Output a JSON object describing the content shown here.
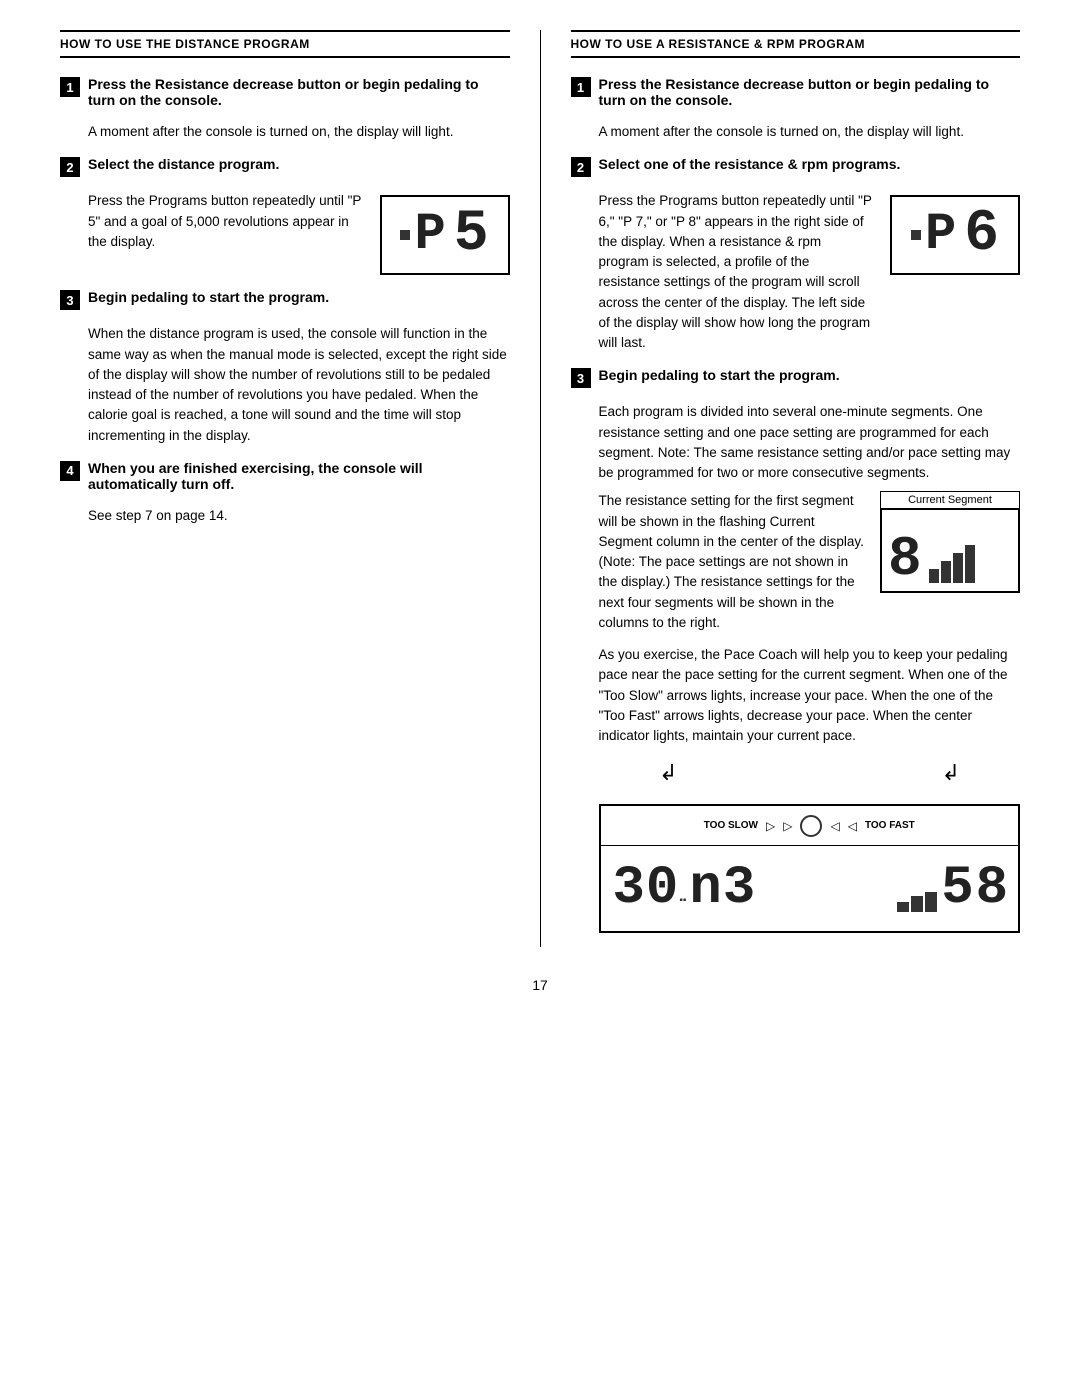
{
  "left_col": {
    "header": "HOW TO USE THE DISTANCE PROGRAM",
    "step1": {
      "number": "1",
      "title": "Press the Resistance decrease button or begin pedaling to turn on the console.",
      "body": "A moment after the console is turned on, the display will light."
    },
    "step2": {
      "number": "2",
      "title": "Select the distance program.",
      "body_pre": "Press the Programs button repeatedly until \"P 5\" and a goal of 5,000 revolutions appear in the display."
    },
    "step3": {
      "number": "3",
      "title": "Begin pedaling to start the program.",
      "body": "When the distance program is used, the console will function in the same way as when the manual mode is selected, except the right side of the display will show the number of revolutions still to be pedaled instead of the number of revolutions you have pedaled. When the calorie goal is reached, a tone will sound and the time will stop incrementing in the display."
    },
    "step4": {
      "number": "4",
      "title": "When you are finished exercising, the console will automatically turn off.",
      "body": "See step 7 on page 14."
    }
  },
  "right_col": {
    "header": "HOW TO USE A RESISTANCE & RPM PROGRAM",
    "step1": {
      "number": "1",
      "title": "Press the Resistance decrease button or begin pedaling to turn on the console.",
      "body": "A moment after the console is turned on, the display will light."
    },
    "step2": {
      "number": "2",
      "title": "Select one of the resistance & rpm programs.",
      "body_pre": "Press the Programs button repeatedly until \"P 6,\" \"P 7,\" or \"P 8\" appears in the right side of the display. When a resistance & rpm program is selected, a profile of the resistance settings of the program will scroll across the center of the display. The left side of the display will show how long the program will last."
    },
    "step3": {
      "number": "3",
      "title": "Begin pedaling to start the program.",
      "body_seg_text": "Each program is divided into several one-minute segments. One resistance setting and one pace setting are programmed for each segment. Note: The same resistance setting and/or pace setting may be programmed for two or more consecutive segments.",
      "body_seg_text2": "The resistance setting for the first segment will be shown in the flashing Current Segment column in the center of the display. (Note: The pace settings are not shown in the display.) The resistance settings for the next four segments will be shown in the columns to the right.",
      "segment_label": "Current Segment",
      "body_pace_text": "As you exercise, the Pace Coach will help you to keep your pedaling pace near the pace setting for the current segment. When one of the \"Too Slow\" arrows lights, increase your pace. When the one of the \"Too Fast\" arrows lights, decrease your pace. When the center indicator lights, maintain your current pace."
    }
  },
  "displays": {
    "p5_chars": [
      "P",
      "5"
    ],
    "p6_chars": [
      "P",
      "6"
    ],
    "segment_big_char": "8",
    "segment_bars": [
      14,
      22,
      30,
      38
    ],
    "pace_bottom_left_chars": [
      "3",
      "0",
      "n",
      "3"
    ],
    "pace_bottom_right_chars": [
      "5",
      "8"
    ],
    "pace_bars": [
      10,
      16,
      20
    ],
    "pace_labels": {
      "too_slow": "TOO SLOW",
      "too_fast": "TOO FAST"
    }
  },
  "page_number": "17"
}
